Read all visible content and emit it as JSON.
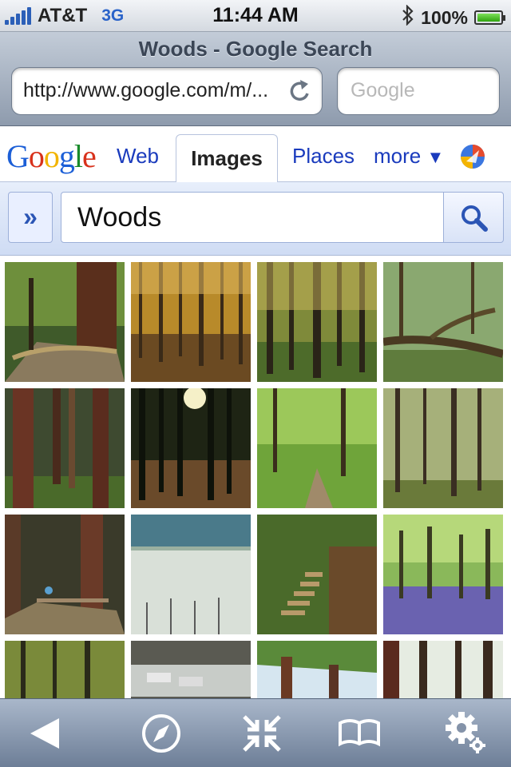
{
  "status_bar": {
    "carrier": "AT&T",
    "network": "3G",
    "time": "11:44 AM",
    "battery_percent": "100%",
    "battery_level": 1.0,
    "icons": [
      "signal-bars-icon",
      "bluetooth-icon",
      "battery-icon"
    ]
  },
  "browser": {
    "page_title": "Woods - Google Search",
    "url": "http://www.google.com/m/...",
    "search_placeholder": "Google"
  },
  "google_nav": {
    "logo_text": [
      "G",
      "o",
      "o",
      "g",
      "l",
      "e"
    ],
    "tabs": [
      {
        "label": "Web"
      },
      {
        "label": "Images",
        "selected": true
      },
      {
        "label": "Places"
      },
      {
        "label": "more"
      }
    ],
    "more_arrow": "▼"
  },
  "search": {
    "expand_label": "»",
    "query": "Woods"
  },
  "images": {
    "results": [
      {
        "scene": "redwood-path"
      },
      {
        "scene": "autumn-birch-woods"
      },
      {
        "scene": "sunlit-trunks"
      },
      {
        "scene": "mossy-fallen-tree"
      },
      {
        "scene": "redwood-grove"
      },
      {
        "scene": "backlit-pines"
      },
      {
        "scene": "green-trail"
      },
      {
        "scene": "sparse-forest"
      },
      {
        "scene": "boardwalk-grove"
      },
      {
        "scene": "misty-trees"
      },
      {
        "scene": "forest-stairs"
      },
      {
        "scene": "bluebell-woods"
      },
      {
        "scene": "forest-edge"
      },
      {
        "scene": "winter-cars"
      },
      {
        "scene": "redwood-canopy"
      },
      {
        "scene": "tall-trunks"
      }
    ]
  },
  "toolbar": {
    "buttons": [
      "back-icon",
      "compass-icon",
      "collapse-icon",
      "bookmarks-icon",
      "settings-icon"
    ]
  },
  "colors": {
    "link_blue": "#1a3bbd",
    "network_blue": "#2a63c9",
    "battery_green": "#2fa30f"
  }
}
